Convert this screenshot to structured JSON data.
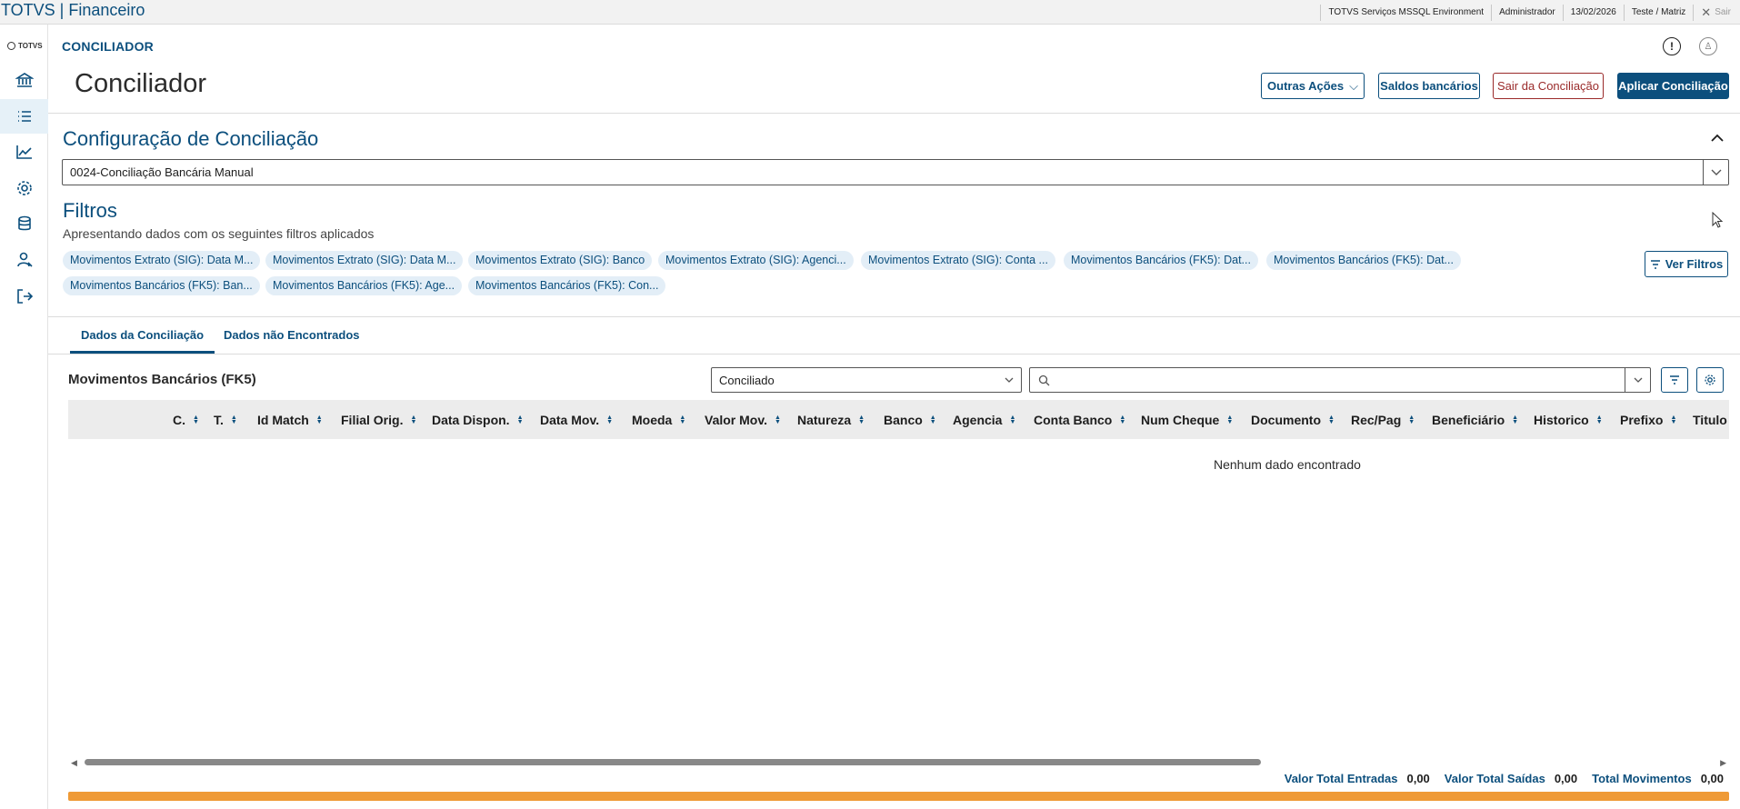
{
  "topbar": {
    "title": "TOTVS | Financeiro",
    "environment": "TOTVS Serviços MSSQL Environment",
    "user": "Administrador",
    "date": "13/02/2026",
    "company": "Teste / Matriz",
    "logout_label": "Sair"
  },
  "sidebar": {
    "logo": "TOTVS",
    "items": [
      {
        "name": "bank-icon"
      },
      {
        "name": "list-icon",
        "active": true
      },
      {
        "name": "chart-line-icon"
      },
      {
        "name": "gear-icon"
      },
      {
        "name": "database-icon"
      },
      {
        "name": "user-settings-icon"
      },
      {
        "name": "exit-icon"
      }
    ]
  },
  "header": {
    "breadcrumb": "CONCILIADOR",
    "title": "Conciliador",
    "info_icon": "info-icon",
    "user_icon": "user-icon",
    "buttons": {
      "outras_acoes": "Outras Ações",
      "saldos": "Saldos bancários",
      "sair_conciliacao": "Sair da Conciliação",
      "aplicar": "Aplicar Conciliação"
    }
  },
  "config": {
    "title": "Configuração de Conciliação",
    "selected": "0024-Conciliação Bancária Manual"
  },
  "filters": {
    "title": "Filtros",
    "subtitle": "Apresentando dados com os seguintes filtros aplicados",
    "chips": [
      "Movimentos Extrato (SIG): Data M...",
      "Movimentos Extrato (SIG): Data M...",
      "Movimentos Extrato (SIG): Banco",
      "Movimentos Extrato (SIG): Agenci...",
      "Movimentos Extrato (SIG): Conta ...",
      "Movimentos Bancários (FK5): Dat...",
      "Movimentos Bancários (FK5): Dat...",
      "Movimentos Bancários (FK5): Ban...",
      "Movimentos Bancários (FK5): Age...",
      "Movimentos Bancários (FK5): Con..."
    ],
    "ver_filtros": "Ver Filtros"
  },
  "tabs": [
    "Dados da Conciliação",
    "Dados não Encontrados"
  ],
  "grid": {
    "title": "Movimentos Bancários (FK5)",
    "status_filter": "Conciliado",
    "search_placeholder": "",
    "columns": [
      "C.",
      "T.",
      "Id Match",
      "Filial Orig.",
      "Data Dispon.",
      "Data Mov.",
      "Moeda",
      "Valor Mov.",
      "Natureza",
      "Banco",
      "Agencia",
      "Conta Banco",
      "Num Cheque",
      "Documento",
      "Rec/Pag",
      "Beneficiário",
      "Historico",
      "Prefixo",
      "Titulo"
    ],
    "empty_message": "Nenhum dado encontrado"
  },
  "totals": {
    "entradas_label": "Valor Total Entradas",
    "entradas_value": "0,00",
    "saidas_label": "Valor Total Saídas",
    "saidas_value": "0,00",
    "movimentos_label": "Total Movimentos",
    "movimentos_value": "0,00"
  },
  "progress": {
    "fraction": 1.0,
    "color": "#ef9a36"
  },
  "colors": {
    "brand": "#0c4f7d",
    "danger": "#9a2a2a",
    "chip_bg": "#e3eef7"
  }
}
